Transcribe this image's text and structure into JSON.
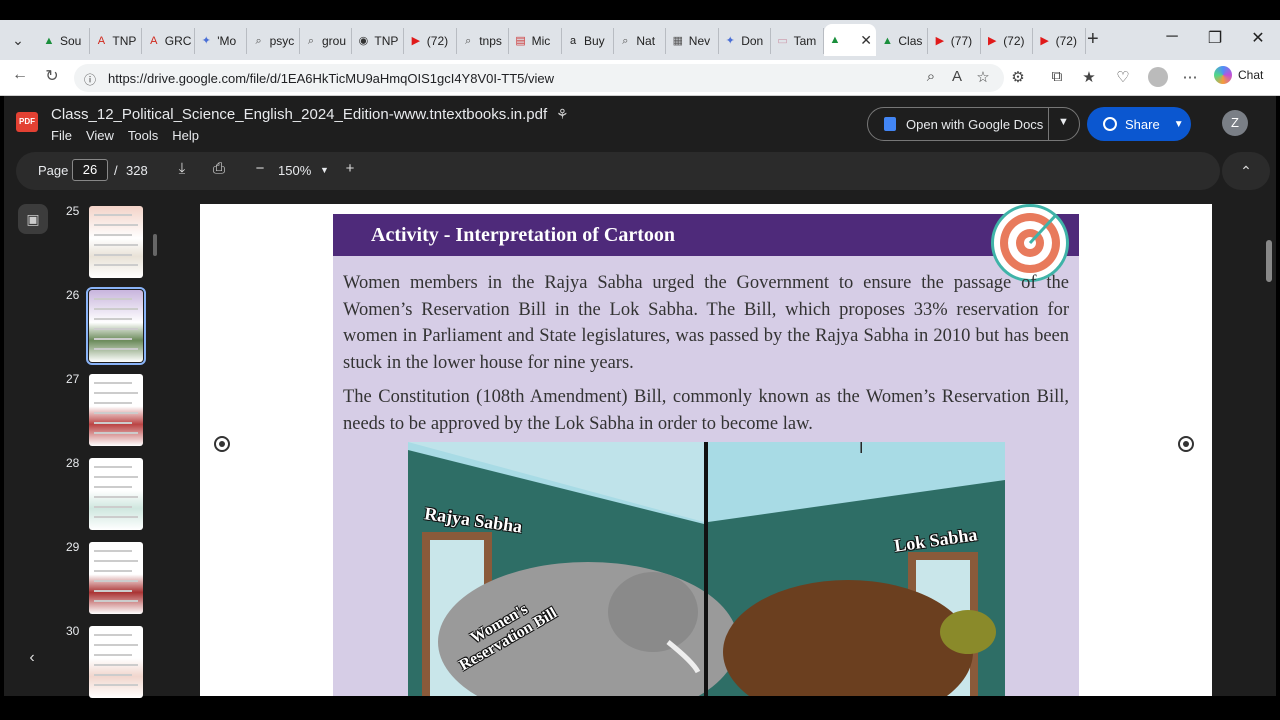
{
  "browser": {
    "tabs": [
      {
        "label": "Sou",
        "icon": "drive-icon"
      },
      {
        "label": "TNP",
        "icon": "adobe-icon"
      },
      {
        "label": "GRC",
        "icon": "adobe-icon"
      },
      {
        "label": "'Mo",
        "icon": "butterfly-icon"
      },
      {
        "label": "psyc",
        "icon": "search-icon"
      },
      {
        "label": "grou",
        "icon": "search-icon"
      },
      {
        "label": "TNP",
        "icon": "globe-icon"
      },
      {
        "label": "(72)",
        "icon": "youtube-icon"
      },
      {
        "label": "tnps",
        "icon": "search-icon"
      },
      {
        "label": "Mic",
        "icon": "pdf-icon"
      },
      {
        "label": "Buy",
        "icon": "amazon-icon"
      },
      {
        "label": "Nat",
        "icon": "search-icon"
      },
      {
        "label": "Nev",
        "icon": "news-icon"
      },
      {
        "label": "Don",
        "icon": "butterfly-icon"
      },
      {
        "label": "Tam",
        "icon": "page-icon"
      },
      {
        "label": "",
        "icon": "drive-icon",
        "active": true
      },
      {
        "label": "Clas",
        "icon": "drive-icon"
      },
      {
        "label": "(77)",
        "icon": "youtube-icon"
      },
      {
        "label": "(72)",
        "icon": "youtube-icon"
      },
      {
        "label": "(72)",
        "icon": "youtube-icon"
      }
    ],
    "url": "https://drive.google.com/file/d/1EA6HkTicMU9aHmqOIS1gcI4Y8V0I-TT5/view",
    "chat_label": "Chat"
  },
  "app": {
    "filename": "Class_12_Political_Science_English_2024_Edition-www.tntextbooks.in.pdf",
    "menus": [
      "File",
      "View",
      "Tools",
      "Help"
    ],
    "open_with": "Open with Google Docs",
    "share": "Share",
    "avatar_letter": "Z"
  },
  "toolbar": {
    "page_label": "Page",
    "page_current": "26",
    "page_sep": "/",
    "page_total": "328",
    "zoom": "150%"
  },
  "thumbnails": [
    {
      "num": "25",
      "selected": false
    },
    {
      "num": "26",
      "selected": true
    },
    {
      "num": "27",
      "selected": false
    },
    {
      "num": "28",
      "selected": false
    },
    {
      "num": "29",
      "selected": false
    },
    {
      "num": "30",
      "selected": false
    }
  ],
  "document": {
    "activity_title": "Activity - Interpretation of Cartoon",
    "para1": "Women members in the Rajya Sabha urged the Government to ensure the passage of the Women’s Reservation Bill in the Lok Sabha. The Bill, which proposes 33% reservation for women in Parliament and State legislatures, was passed by the Rajya Sabha in 2010 but has been stuck in the lower house for nine years.",
    "para2": "The Constitution (108th Amendment) Bill, commonly known as the Women’s Reservation Bill, needs to be approved by the Lok Sabha in order to become law.",
    "cartoon": {
      "left_label": "Rajya Sabha",
      "right_label": "Lok Sabha",
      "elephant_label": "Women's Reservation Bill"
    }
  },
  "colors": {
    "activity_bar": "#4e2a7a",
    "page_bg": "#d6cde6",
    "share_blue": "#0b57d0"
  }
}
